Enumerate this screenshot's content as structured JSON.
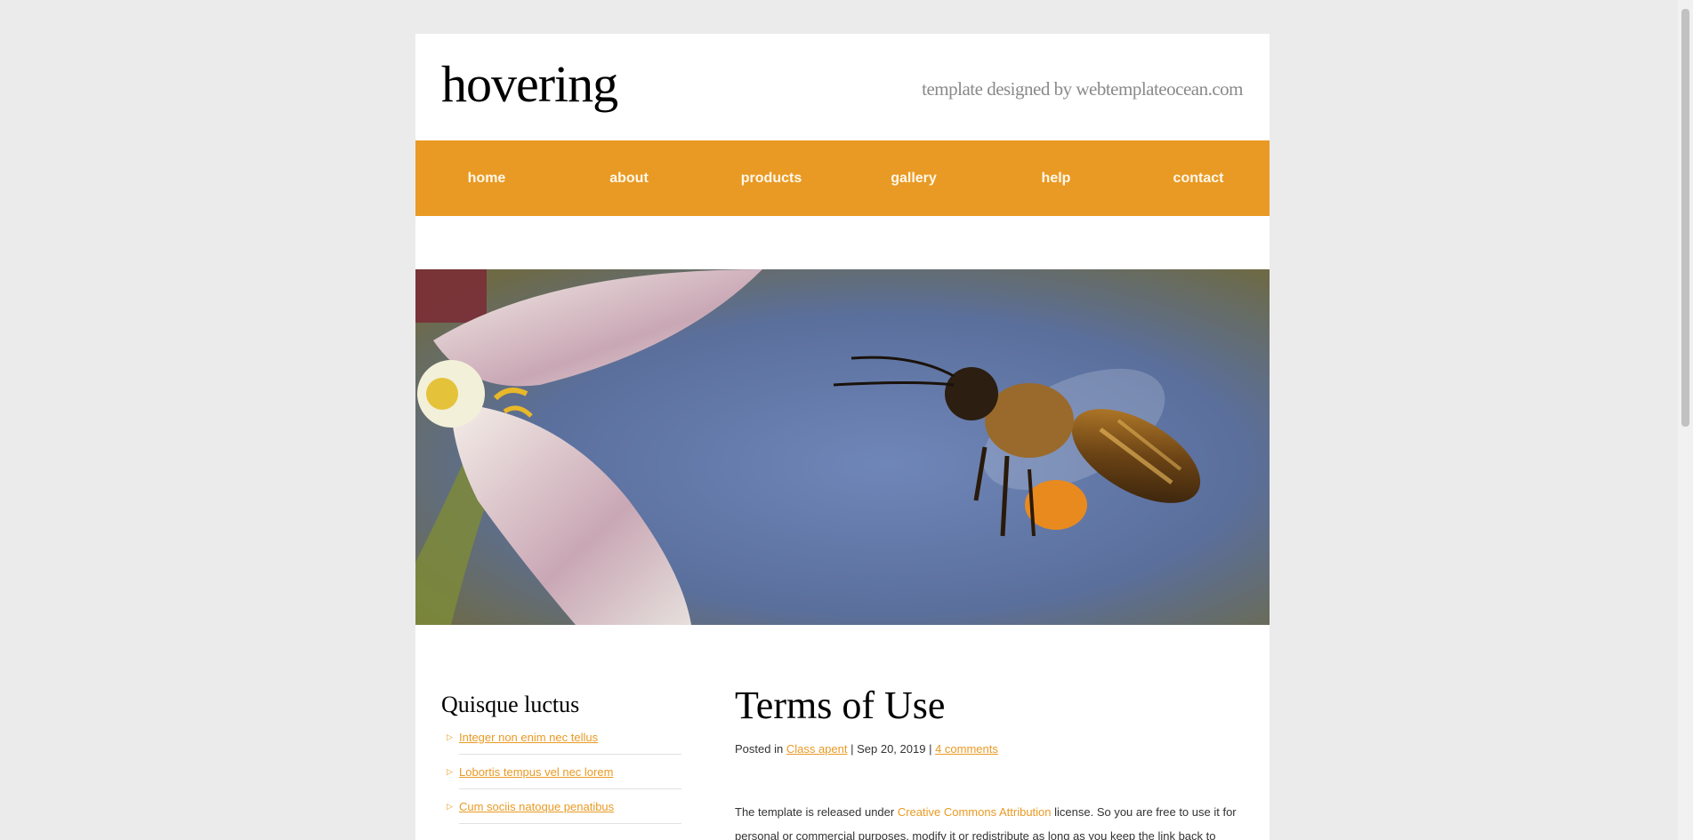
{
  "site": {
    "logo": "hovering",
    "tagline": "template designed by webtemplateocean.com"
  },
  "nav": {
    "items": [
      {
        "label": "home"
      },
      {
        "label": "about"
      },
      {
        "label": "products"
      },
      {
        "label": "gallery"
      },
      {
        "label": "help"
      },
      {
        "label": "contact"
      }
    ]
  },
  "sidebar": {
    "title": "Quisque luctus",
    "links": [
      {
        "label": "Integer non enim nec tellus"
      },
      {
        "label": "Lobortis tempus vel nec lorem"
      },
      {
        "label": "Cum sociis natoque penatibus"
      }
    ]
  },
  "article": {
    "title": "Terms of Use",
    "meta": {
      "posted_in": "Posted in",
      "category": "Class apent",
      "sep1": " | ",
      "date": "Sep 20, 2019",
      "sep2": " | ",
      "comments": "4 comments"
    },
    "body": {
      "part1": "The template is released under ",
      "link": "Creative Commons Attribution",
      "part2": " license. So you are free to use it for personal or commercial purposes, modify it or redistribute as long as you keep the link back to"
    }
  },
  "colors": {
    "accent": "#e99a24",
    "background": "#ebebeb",
    "page": "#ffffff"
  }
}
